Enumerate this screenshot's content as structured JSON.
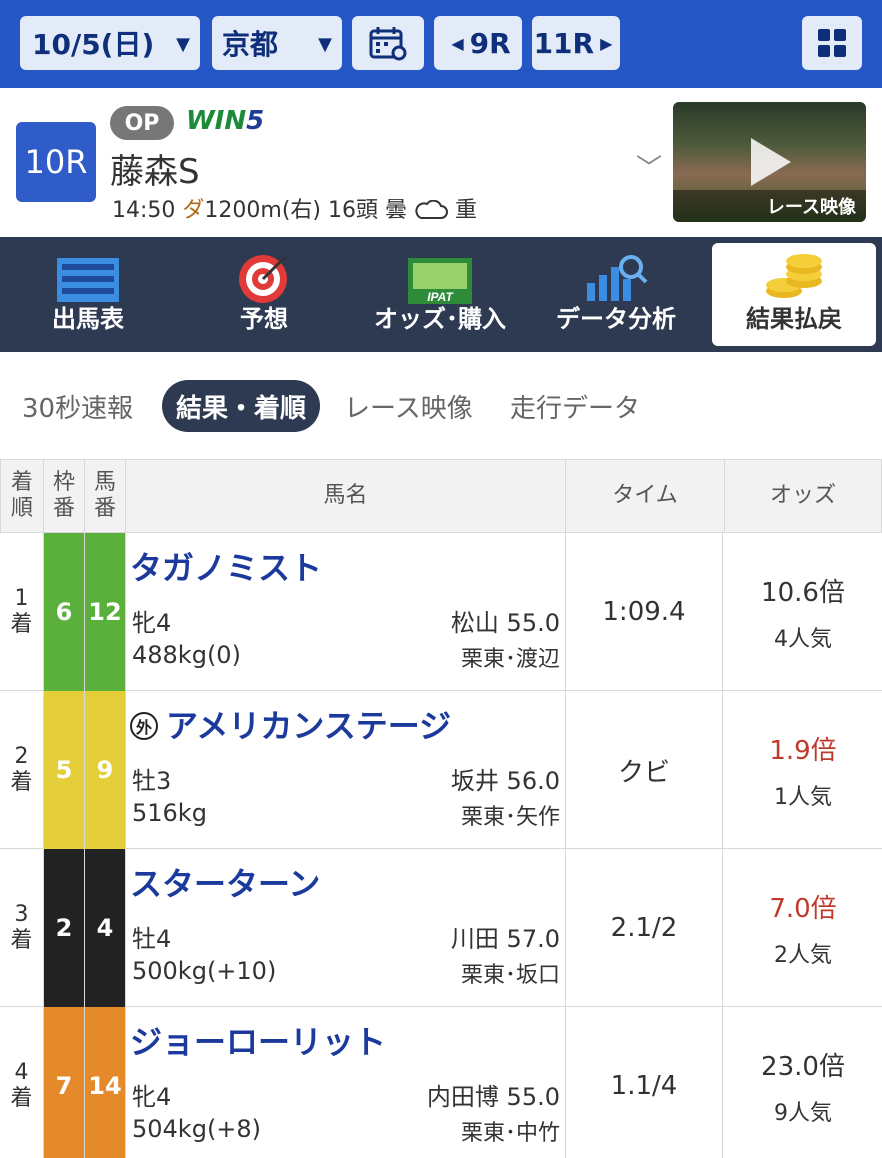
{
  "topbar": {
    "date": "10/5(日)",
    "place": "京都",
    "prev_race": "9R",
    "next_race": "11R"
  },
  "race": {
    "number": "10R",
    "grade": "OP",
    "win5_prefix": "WIN",
    "win5_num": "5",
    "name": "藤森S",
    "time": "14:50",
    "surface": "ダ",
    "distance": "1200m(右)",
    "runners": "16頭",
    "weather": "曇",
    "condition": "重",
    "video_label": "レース映像"
  },
  "nav": [
    {
      "label": "出馬表",
      "icon": "entry-table-icon"
    },
    {
      "label": "予想",
      "icon": "target-icon"
    },
    {
      "label": "オッズ･購入",
      "icon": "ipat-icon"
    },
    {
      "label": "データ分析",
      "icon": "chart-search-icon"
    },
    {
      "label": "結果払戻",
      "icon": "coins-icon"
    }
  ],
  "subtabs": [
    "30秒速報",
    "結果・着順",
    "レース映像",
    "走行データ"
  ],
  "table": {
    "headers": {
      "rank": "着順",
      "waku": "枠番",
      "umaban": "馬番",
      "name": "馬名",
      "time": "タイム",
      "odds": "オッズ"
    },
    "rows": [
      {
        "rank_num": "1",
        "rank_unit": "着",
        "waku": "6",
        "umaban": "12",
        "waku_color": "#5ab03a",
        "name": "タガノミスト",
        "foreign": false,
        "sexage": "牝4",
        "jockey": "松山 55.0",
        "weight": "488kg(0)",
        "trainer": "栗東･渡辺",
        "time": "1:09.4",
        "odds": "10.6倍",
        "popularity": "4人気",
        "hot": false
      },
      {
        "rank_num": "2",
        "rank_unit": "着",
        "waku": "5",
        "umaban": "9",
        "waku_color": "#e4cf3a",
        "name": "アメリカンステージ",
        "foreign": true,
        "foreign_mark": "外",
        "sexage": "牡3",
        "jockey": "坂井 56.0",
        "weight": "516kg",
        "trainer": "栗東･矢作",
        "time": "クビ",
        "odds": "1.9倍",
        "popularity": "1人気",
        "hot": true
      },
      {
        "rank_num": "3",
        "rank_unit": "着",
        "waku": "2",
        "umaban": "4",
        "waku_color": "#222222",
        "name": "スターターン",
        "foreign": false,
        "sexage": "牡4",
        "jockey": "川田 57.0",
        "weight": "500kg(+10)",
        "trainer": "栗東･坂口",
        "time": "2.1/2",
        "odds": "7.0倍",
        "popularity": "2人気",
        "hot": true
      },
      {
        "rank_num": "4",
        "rank_unit": "着",
        "waku": "7",
        "umaban": "14",
        "waku_color": "#e58a2a",
        "name": "ジョーローリット",
        "foreign": false,
        "sexage": "牝4",
        "jockey": "内田博 55.0",
        "weight": "504kg(+8)",
        "trainer": "栗東･中竹",
        "time": "1.1/4",
        "odds": "23.0倍",
        "popularity": "9人気",
        "hot": false
      }
    ]
  }
}
